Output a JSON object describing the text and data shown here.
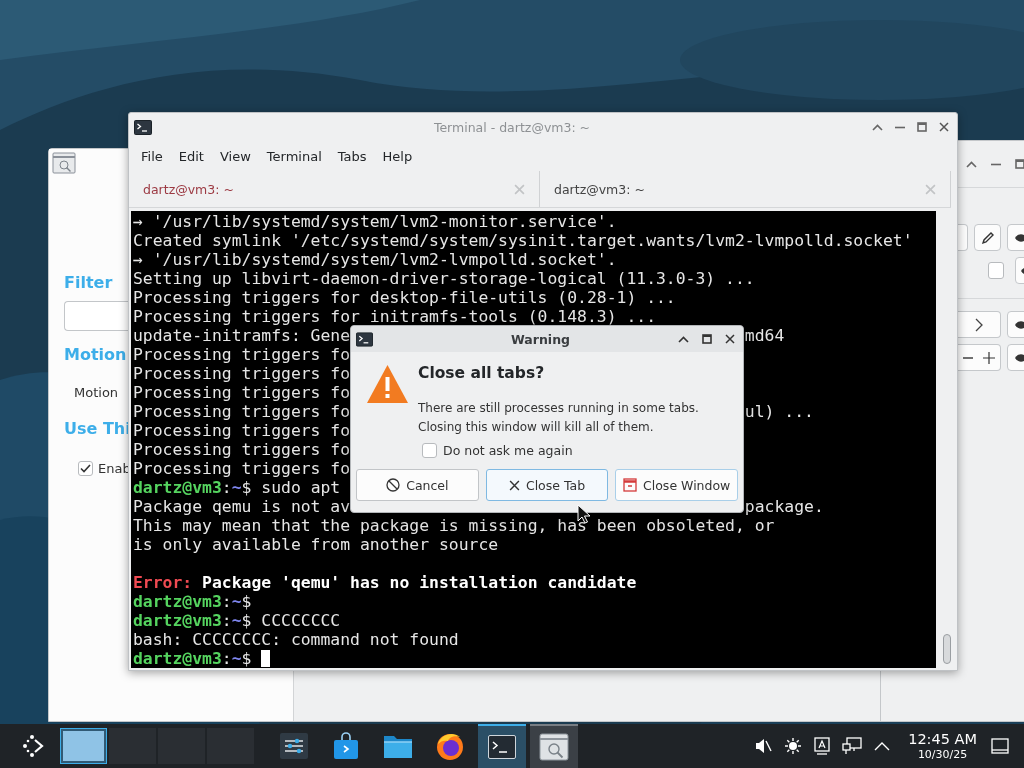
{
  "left_window": {
    "filter_heading": "Filter",
    "motion_heading": "Motion",
    "motion_label": "Motion",
    "use_heading": "Use Thi",
    "enable_checkbox": {
      "label": "Enab",
      "checked": true
    }
  },
  "right_window": {
    "checkbox": {
      "checked": false
    }
  },
  "terminal": {
    "title": "Terminal - dartz@vm3: ~",
    "menu": [
      "File",
      "Edit",
      "View",
      "Terminal",
      "Tabs",
      "Help"
    ],
    "tabs": [
      {
        "label": "dartz@vm3: ~",
        "selected": true
      },
      {
        "label": "dartz@vm3: ~",
        "selected": false
      }
    ],
    "lines": [
      {
        "kind": "text",
        "parts": [
          {
            "text": "→ '/usr/lib/systemd/system/lvm2-monitor.service'.",
            "kind": "plain"
          }
        ]
      },
      {
        "kind": "text",
        "parts": [
          {
            "text": "Created symlink '/etc/systemd/system/sysinit.target.wants/lvm2-lvmpolld.socket'",
            "kind": "plain"
          }
        ]
      },
      {
        "kind": "text",
        "parts": [
          {
            "text": "→ '/usr/lib/systemd/system/lvm2-lvmpolld.socket'.",
            "kind": "plain"
          }
        ]
      },
      {
        "kind": "text",
        "parts": [
          {
            "text": "Setting up libvirt-daemon-driver-storage-logical (11.3.0-3) ...",
            "kind": "plain"
          }
        ]
      },
      {
        "kind": "text",
        "parts": [
          {
            "text": "Processing triggers for desktop-file-utils (0.28-1) ...",
            "kind": "plain"
          }
        ]
      },
      {
        "kind": "text",
        "parts": [
          {
            "text": "Processing triggers for initramfs-tools (0.148.3) ...",
            "kind": "plain"
          }
        ]
      },
      {
        "kind": "text",
        "parts": [
          {
            "text": "update-initramfs: Gene",
            "kind": "plain"
          }
        ],
        "right": [
          {
            "text": "md64",
            "kind": "plain"
          }
        ]
      },
      {
        "kind": "text",
        "parts": [
          {
            "text": "Processing triggers fo",
            "kind": "plain"
          }
        ]
      },
      {
        "kind": "text",
        "parts": [
          {
            "text": "Processing triggers fo",
            "kind": "plain"
          }
        ]
      },
      {
        "kind": "text",
        "parts": [
          {
            "text": "Processing triggers fo",
            "kind": "plain"
          }
        ]
      },
      {
        "kind": "text",
        "parts": [
          {
            "text": "Processing triggers fo",
            "kind": "plain"
          }
        ],
        "right": [
          {
            "text": "ul) ...",
            "kind": "plain"
          }
        ]
      },
      {
        "kind": "text",
        "parts": [
          {
            "text": "Processing triggers fo",
            "kind": "plain"
          }
        ]
      },
      {
        "kind": "text",
        "parts": [
          {
            "text": "Processing triggers fo",
            "kind": "plain"
          }
        ]
      },
      {
        "kind": "text",
        "parts": [
          {
            "text": "Processing triggers fo",
            "kind": "plain"
          }
        ]
      },
      {
        "kind": "text",
        "parts": [
          {
            "text": "dartz@vm3",
            "kind": "user"
          },
          {
            "text": ":",
            "kind": "plain"
          },
          {
            "text": "~",
            "kind": "path"
          },
          {
            "text": "$ sudo apt",
            "kind": "plain"
          }
        ]
      },
      {
        "kind": "text",
        "parts": [
          {
            "text": "Package qemu is not av",
            "kind": "plain"
          }
        ],
        "right": [
          {
            "text": "package.",
            "kind": "plain"
          }
        ]
      },
      {
        "kind": "text",
        "parts": [
          {
            "text": "This may mean that the package is missing, has been obsoleted, or",
            "kind": "plain"
          }
        ]
      },
      {
        "kind": "text",
        "parts": [
          {
            "text": "is only available from another source",
            "kind": "plain"
          }
        ]
      },
      {
        "kind": "blank"
      },
      {
        "kind": "text",
        "parts": [
          {
            "text": "Error:",
            "kind": "error"
          },
          {
            "text": " Package 'qemu' has no installation candidate",
            "kind": "bold"
          }
        ]
      },
      {
        "kind": "text",
        "parts": [
          {
            "text": "dartz@vm3",
            "kind": "user"
          },
          {
            "text": ":",
            "kind": "plain"
          },
          {
            "text": "~",
            "kind": "path"
          },
          {
            "text": "$",
            "kind": "plain"
          }
        ]
      },
      {
        "kind": "text",
        "parts": [
          {
            "text": "dartz@vm3",
            "kind": "user"
          },
          {
            "text": ":",
            "kind": "plain"
          },
          {
            "text": "~",
            "kind": "path"
          },
          {
            "text": "$ CCCCCCCC",
            "kind": "plain"
          }
        ]
      },
      {
        "kind": "text",
        "parts": [
          {
            "text": "bash: CCCCCCCC: command not found",
            "kind": "plain"
          }
        ]
      },
      {
        "kind": "text",
        "parts": [
          {
            "text": "dartz@vm3",
            "kind": "user"
          },
          {
            "text": ":",
            "kind": "plain"
          },
          {
            "text": "~",
            "kind": "path"
          },
          {
            "text": "$",
            "kind": "plain"
          }
        ],
        "cursor": true
      }
    ]
  },
  "dialog": {
    "title": "Warning",
    "heading": "Close all tabs?",
    "message_lines": [
      "There are still processes running in some tabs.",
      "Closing this window will kill all of them."
    ],
    "checkbox": {
      "label": "Do not ask me again",
      "checked": false
    },
    "buttons": [
      {
        "label": "Cancel",
        "kind": "cancel",
        "hovered": false,
        "default": false
      },
      {
        "label": "Close Tab",
        "kind": "close-tab",
        "hovered": true,
        "default": false
      },
      {
        "label": "Close Window",
        "kind": "close-window",
        "hovered": false,
        "default": true
      }
    ]
  },
  "taskbar": {
    "pager": [
      {
        "selected": true
      },
      {
        "selected": false
      },
      {
        "selected": false
      },
      {
        "selected": false
      }
    ],
    "apps": [
      {
        "kind": "settings",
        "active": false,
        "open": false
      },
      {
        "kind": "store",
        "active": false,
        "open": false
      },
      {
        "kind": "files",
        "active": false,
        "open": false
      },
      {
        "kind": "browser",
        "active": false,
        "open": false
      },
      {
        "kind": "terminal",
        "active": true,
        "open": true
      },
      {
        "kind": "viewer",
        "active": false,
        "open": true
      }
    ],
    "clock": {
      "time": "12:45 AM",
      "date": "10/30/25"
    }
  }
}
